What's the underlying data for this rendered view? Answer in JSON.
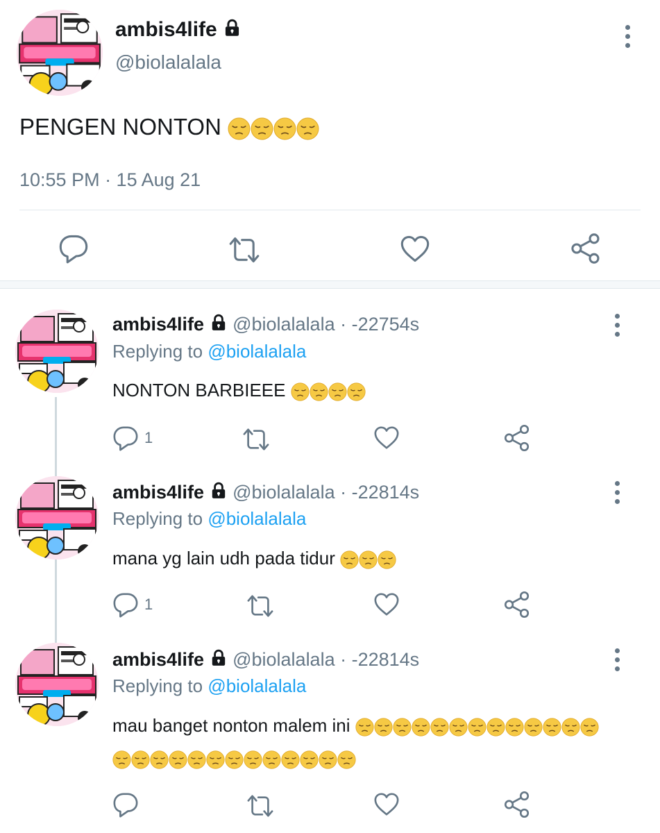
{
  "main_tweet": {
    "display_name": "ambis4life",
    "handle": "@biolalalala",
    "text": "PENGEN NONTON",
    "emoji_count": 4,
    "timestamp": "10:55 PM · 15 Aug 21"
  },
  "replies": [
    {
      "display_name": "ambis4life",
      "handle": "@biolalalala",
      "separator": " · ",
      "time": "-22754s",
      "replying_label": "Replying to",
      "replying_handle": "@biolalalala",
      "text": "NONTON BARBIEEE",
      "emoji_count": 4,
      "reply_count": "1"
    },
    {
      "display_name": "ambis4life",
      "handle": "@biolalalala",
      "separator": " · ",
      "time": "-22814s",
      "replying_label": "Replying to",
      "replying_handle": "@biolalalala",
      "text": "mana yg lain udh pada tidur",
      "emoji_count": 3,
      "reply_count": "1"
    },
    {
      "display_name": "ambis4life",
      "handle": "@biolalalala",
      "separator": " · ",
      "time": "-22814s",
      "replying_label": "Replying to",
      "replying_handle": "@biolalalala",
      "text": "mau banget nonton malem ini",
      "emoji_count": 13,
      "emoji_count_line2": 13,
      "reply_count": ""
    }
  ],
  "icons": {
    "lock": "lock-icon",
    "reply": "reply-icon",
    "retweet": "retweet-icon",
    "like": "heart-icon",
    "share": "share-icon",
    "more": "more-vertical-icon",
    "emoji": "pensive-face-emoji"
  },
  "colors": {
    "link": "#1da1f2",
    "muted": "#657786",
    "text": "#14171a",
    "divider": "#e1e8ed",
    "emoji": "#f6c944"
  }
}
